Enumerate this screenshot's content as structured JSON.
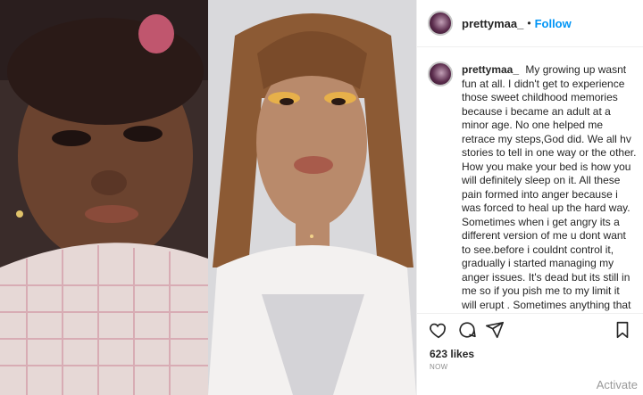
{
  "post": {
    "username": "prettymaa_",
    "dot": "•",
    "follow_label": "Follow",
    "caption_user": "prettymaa_",
    "caption_text": "My growing up wasnt fun at all. I didn't get to experience those sweet childhood memories because i became an adult at a minor age. No one helped me retrace my steps,God did. We all hv stories to tell in one way or the other. How you make your bed is how you will definitely sleep on it. All these pain formed into anger because i was forced to heal up the hard way. Sometimes when i get angry its a different version of me u dont want to see.before i couldnt control it, gradually i started managing my anger issues. It's dead but its still in me so if you pish me to my limit it will erupt . Sometimes anything that will trouble my peace ,i try to avoid it , i either keep calm or walk away but if you push it well... So thank you for",
    "likes": "623 likes",
    "time": "NOW"
  },
  "overlay": {
    "activate": "Activate"
  },
  "icons": {
    "like": "heart-icon",
    "comment": "comment-icon",
    "share": "share-icon",
    "save": "bookmark-icon"
  },
  "colors": {
    "follow": "#0095f6",
    "border": "#efefef",
    "muted": "#8e8e8e"
  }
}
